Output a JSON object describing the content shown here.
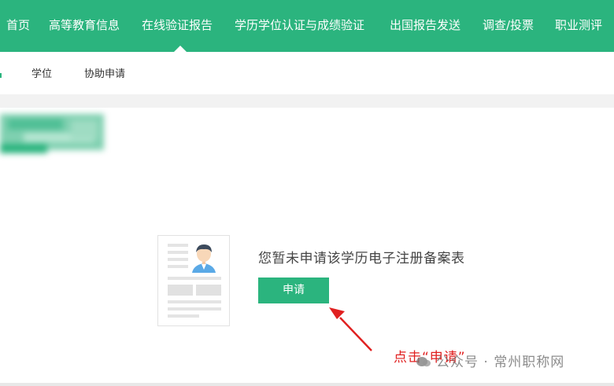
{
  "topnav": {
    "items": [
      "首页",
      "高等教育信息",
      "在线验证报告",
      "学历学位认证与成绩验证",
      "出国报告发送",
      "调查/投票",
      "职业测评"
    ],
    "active_index": 2
  },
  "subnav": {
    "items": [
      "学位",
      "协助申请"
    ]
  },
  "empty_state": {
    "message": "您暂未申请该学历电子注册备案表",
    "apply_button": "申请"
  },
  "annotation": {
    "text": "点击“申请”",
    "color": "#e02020"
  },
  "watermark": {
    "text": "公众号 · 常州职称网"
  },
  "colors": {
    "brand_green": "#2bb47e",
    "arrow_red": "#e02020"
  }
}
